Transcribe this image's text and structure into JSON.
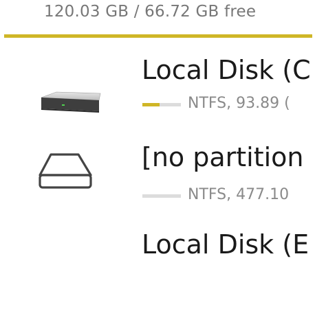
{
  "summary": {
    "text": "120.03 GB / 66.72 GB free"
  },
  "colors": {
    "accent": "#cfb627",
    "bar_track": "#dcdcdc"
  },
  "drives": [
    {
      "name": "Local Disk (C",
      "details": "NTFS, 93.89 (",
      "usage_fraction": 0.45,
      "icon": "hard-drive-icon"
    },
    {
      "name": "[no partition",
      "details": "NTFS, 477.10",
      "usage_fraction": 0.0,
      "icon": "drive-outline-icon"
    },
    {
      "name": "Local Disk (E",
      "details": "",
      "usage_fraction": 0.0,
      "icon": "hard-drive-icon"
    }
  ]
}
